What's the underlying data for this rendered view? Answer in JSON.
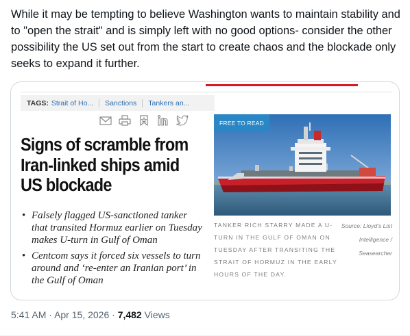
{
  "tweet": {
    "text": "While it may be tempting to believe Washington wants to maintain stability and to \"open the strait\"  and is simply left with no good options- consider the other possibility the US set out from the start to create chaos and the blockade only seeks to expand it further."
  },
  "card": {
    "tags_label": "TAGS:",
    "tags": [
      "Strait of Ho...",
      "Sanctions",
      "Tankers an..."
    ],
    "share_icons": [
      "email-icon",
      "print-icon",
      "bookmark-icon",
      "linkedin-icon",
      "twitter-icon"
    ],
    "headline": "Signs of scramble from Iran-linked ships amid US blockade",
    "bullets": [
      "Falsely flagged US-sanctioned tanker that transited Hormuz earlier on Tuesday makes U-turn in Gulf of Oman",
      "Centcom says it forced six vessels to turn around and ‘re-enter an Iranian port’ in the Gulf of Oman"
    ],
    "badge": "FREE TO READ",
    "caption": "Tanker Rich Starry made a U-turn in the Gulf of Oman on Tuesday after transiting the Strait of Hormuz in the early hours of the day.",
    "source": "Source: Lloyd's List Intelligence / Seasearcher",
    "colors": {
      "accent_red": "#d71920",
      "tag_blue": "#2a6db0",
      "badge_blue": "#2a86c5"
    }
  },
  "meta": {
    "time": "5:41 AM",
    "dot1": "·",
    "date": "Apr 15, 2026",
    "dot2": "·",
    "views_count": "7,482",
    "views_label": "Views"
  }
}
